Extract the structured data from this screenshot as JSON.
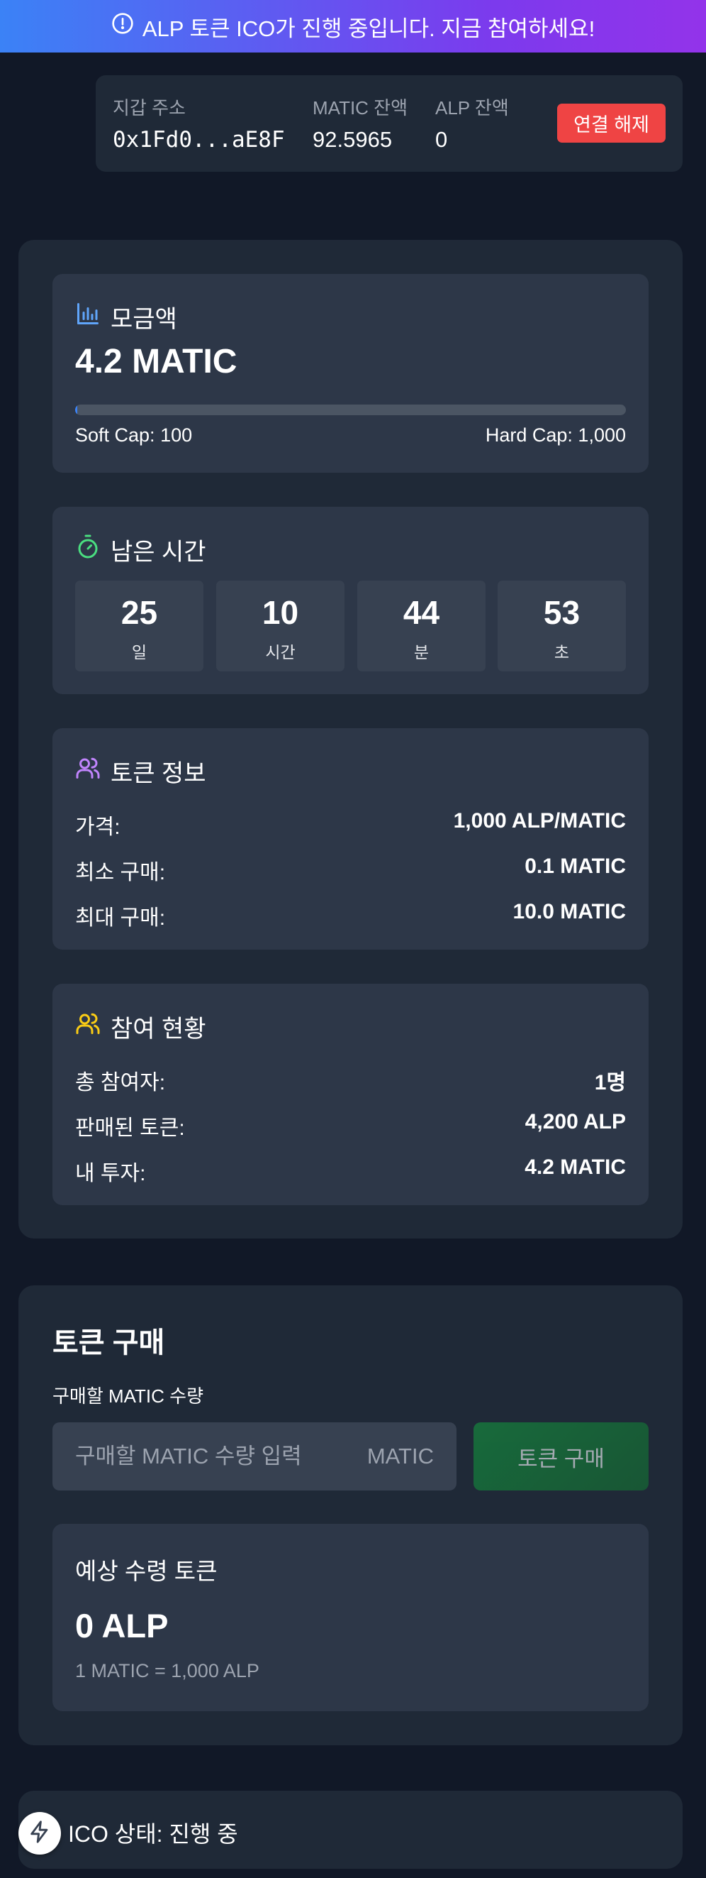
{
  "banner": {
    "text": "ALP 토큰 ICO가 진행 중입니다. 지금 참여하세요!"
  },
  "wallet": {
    "address_label": "지갑 주소",
    "address": "0x1Fd0...aE8F",
    "matic_label": "MATIC 잔액",
    "matic_balance": "92.5965",
    "alp_label": "ALP 잔액",
    "alp_balance": "0",
    "disconnect_label": "연결 해제"
  },
  "raised": {
    "title": "모금액",
    "amount": "4.2 MATIC",
    "progress_percent": 0.42,
    "soft_cap": "Soft Cap: 100",
    "hard_cap": "Hard Cap: 1,000"
  },
  "countdown": {
    "title": "남은 시간",
    "units": [
      {
        "value": "25",
        "label": "일"
      },
      {
        "value": "10",
        "label": "시간"
      },
      {
        "value": "44",
        "label": "분"
      },
      {
        "value": "53",
        "label": "초"
      }
    ]
  },
  "token_info": {
    "title": "토큰 정보",
    "rows": [
      {
        "label": "가격:",
        "value": "1,000 ALP/MATIC"
      },
      {
        "label": "최소 구매:",
        "value": "0.1 MATIC"
      },
      {
        "label": "최대 구매:",
        "value": "10.0 MATIC"
      }
    ]
  },
  "participation": {
    "title": "참여 현황",
    "rows": [
      {
        "label": "총 참여자:",
        "value": "1명"
      },
      {
        "label": "판매된 토큰:",
        "value": "4,200 ALP"
      },
      {
        "label": "내 투자:",
        "value": "4.2 MATIC"
      }
    ]
  },
  "purchase": {
    "title": "토큰 구매",
    "input_label": "구매할 MATIC 수량",
    "input_placeholder": "구매할 MATIC 수량 입력",
    "input_value": "",
    "unit": "MATIC",
    "buy_label": "토큰 구매",
    "estimate_title": "예상 수령 토큰",
    "estimate_value": "0 ALP",
    "rate": "1 MATIC = 1,000 ALP"
  },
  "status": {
    "text": "ICO 상태: 진행 중"
  },
  "icons": {
    "banner": "alert-circle-icon",
    "raised": "bar-chart-icon",
    "countdown": "timer-icon",
    "token_info": "users-icon",
    "participation": "users-icon",
    "fab": "lightning-icon"
  },
  "colors": {
    "background": "#111827",
    "panel": "#1f2937",
    "card": "#2d3748",
    "banner_start": "#3b82f6",
    "banner_end": "#9333ea",
    "disconnect": "#ef4444",
    "progress": "#3b82f6",
    "buy_button": "#15803d",
    "raised_icon": "#60a5fa",
    "timer_icon": "#4ade80",
    "token_icon": "#c084fc",
    "participation_icon": "#facc15"
  }
}
